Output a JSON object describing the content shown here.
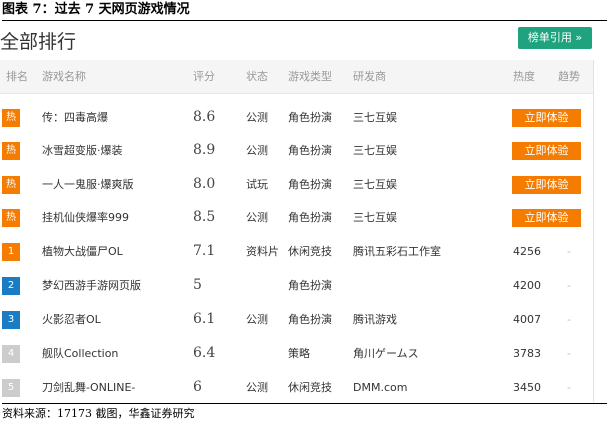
{
  "figure_title": "图表 7：过去 7 天网页游戏情况",
  "panel": {
    "title": "全部排行",
    "quote_button": "榜单引用 »"
  },
  "columns": [
    "排名",
    "游戏名称",
    "评分",
    "状态",
    "游戏类型",
    "研发商",
    "热度",
    "趋势"
  ],
  "colors": {
    "hot": "#f57c00",
    "rank1": "#f57c00",
    "rank2": "#1a7dc4",
    "rank3": "#1a7dc4",
    "rank_other": "#cccccc",
    "quote": "#1fa37f"
  },
  "rows": [
    {
      "badge": "热",
      "badge_type": "hot",
      "name": "传：四毒高爆",
      "score": "8.6",
      "status": "公测",
      "type": "角色扮演",
      "developer": "三七互娱",
      "heat": "",
      "action": "立即体验",
      "trend": ""
    },
    {
      "badge": "热",
      "badge_type": "hot",
      "name": "冰雪超变版·爆装",
      "score": "8.9",
      "status": "公测",
      "type": "角色扮演",
      "developer": "三七互娱",
      "heat": "",
      "action": "立即体验",
      "trend": ""
    },
    {
      "badge": "热",
      "badge_type": "hot",
      "name": "一人一鬼服·爆爽版",
      "score": "8.0",
      "status": "试玩",
      "type": "角色扮演",
      "developer": "三七互娱",
      "heat": "",
      "action": "立即体验",
      "trend": ""
    },
    {
      "badge": "热",
      "badge_type": "hot",
      "name": "挂机仙侠爆率999",
      "score": "8.5",
      "status": "公测",
      "type": "角色扮演",
      "developer": "三七互娱",
      "heat": "",
      "action": "立即体验",
      "trend": ""
    },
    {
      "badge": "1",
      "badge_type": "rank1",
      "name": "植物大战僵尸OL",
      "score": "7.1",
      "status": "资料片",
      "type": "休闲竞技",
      "developer": "腾讯五彩石工作室",
      "heat": "4256",
      "action": "",
      "trend": "-"
    },
    {
      "badge": "2",
      "badge_type": "rank2",
      "name": "梦幻西游手游网页版",
      "score": "5",
      "status": "",
      "type": "角色扮演",
      "developer": "",
      "heat": "4200",
      "action": "",
      "trend": "-"
    },
    {
      "badge": "3",
      "badge_type": "rank3",
      "name": "火影忍者OL",
      "score": "6.1",
      "status": "公测",
      "type": "角色扮演",
      "developer": "腾讯游戏",
      "heat": "4007",
      "action": "",
      "trend": "-"
    },
    {
      "badge": "4",
      "badge_type": "rank_other",
      "name": "舰队Collection",
      "score": "6.4",
      "status": "",
      "type": "策略",
      "developer": "角川ゲームス",
      "heat": "3783",
      "action": "",
      "trend": "-"
    },
    {
      "badge": "5",
      "badge_type": "rank_other",
      "name": "刀剑乱舞-ONLINE-",
      "score": "6",
      "status": "公测",
      "type": "休闲竞技",
      "developer": "DMM.com",
      "heat": "3450",
      "action": "",
      "trend": "-"
    }
  ],
  "source": "资料来源：17173 截图，华鑫证券研究"
}
